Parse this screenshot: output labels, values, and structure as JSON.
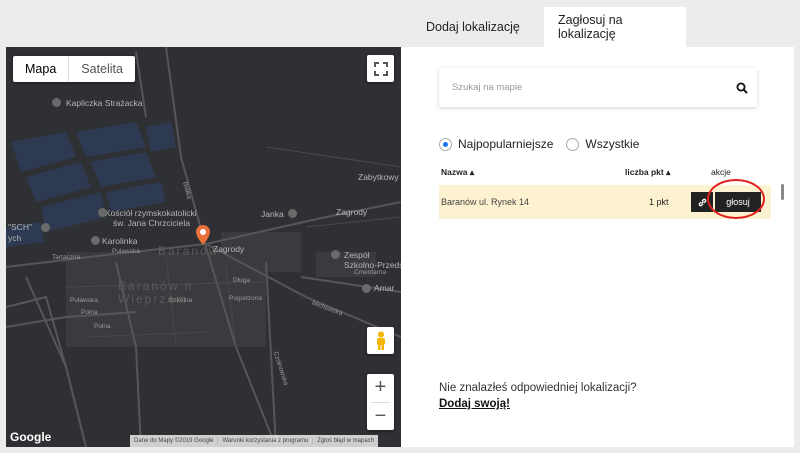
{
  "tabs": {
    "add_location": "Dodaj lokalizację",
    "vote_location": "Zagłosuj na lokalizację"
  },
  "map": {
    "type_map": "Mapa",
    "type_satellite": "Satelita",
    "logo": "Google",
    "attribution": {
      "data": "Dane do Mapy ©2019 Google",
      "terms": "Warunki korzystania z programu",
      "report": "Zgłoś błąd w mapach"
    },
    "labels": {
      "chapel": "Kapliczka Strażacka",
      "church1": "Kościół rzymskokatolicki",
      "church2": "św. Jana Chrzciciela",
      "town": "Baranów",
      "town2": "Baranów n",
      "town3": "Wieprzem",
      "zabytkowy": "Zabytkowy",
      "zagrody1": "Zagrody",
      "zagrody2": "Zagrody",
      "janka": "Janka",
      "karolinka": "Karolinka",
      "pulawska": "Puławska",
      "tartaczna": "Tartaczna",
      "sch": "\"SCH\"",
      "sch2": "ych",
      "zespol1": "Zespół",
      "zespol2": "Szkolno-Przedszk",
      "michowska": "Michowska",
      "amar": "Amar",
      "bialka": "Białka",
      "czolnowska": "Czółnowska",
      "cmentarna": "Cmentarna",
      "pulawska2": "Puławska",
      "polna": "Polna",
      "polna2": "Polna",
      "szkolna": "Szkolna",
      "dluga": "Długa",
      "pogodzona": "Pogodzona"
    },
    "icons": {
      "fullscreen": "fullscreen-icon",
      "pegman": "pegman-icon",
      "zoom_in": "+",
      "zoom_out": "−"
    }
  },
  "panel": {
    "search": {
      "placeholder": "Szukaj na mapie",
      "value": ""
    },
    "filters": {
      "popular": "Najpopularniejsze",
      "all": "Wszystkie",
      "selected": "popular"
    },
    "table": {
      "headers": {
        "name": "Nazwa ▴",
        "points": "liczba pkt ▴",
        "actions": "akcje"
      },
      "rows": [
        {
          "name": "Baranów ul. Rynek 14",
          "points": "1 pkt",
          "vote": "głosuj"
        }
      ]
    },
    "not_found": "Nie znalazłeś odpowiedniej lokalizacji?",
    "add_own": "Dodaj swoją!"
  },
  "colors": {
    "accent": "#1a73e8",
    "row_highlight": "#fdf2cf",
    "pin": "#e8703a",
    "circle": "#e02020"
  }
}
